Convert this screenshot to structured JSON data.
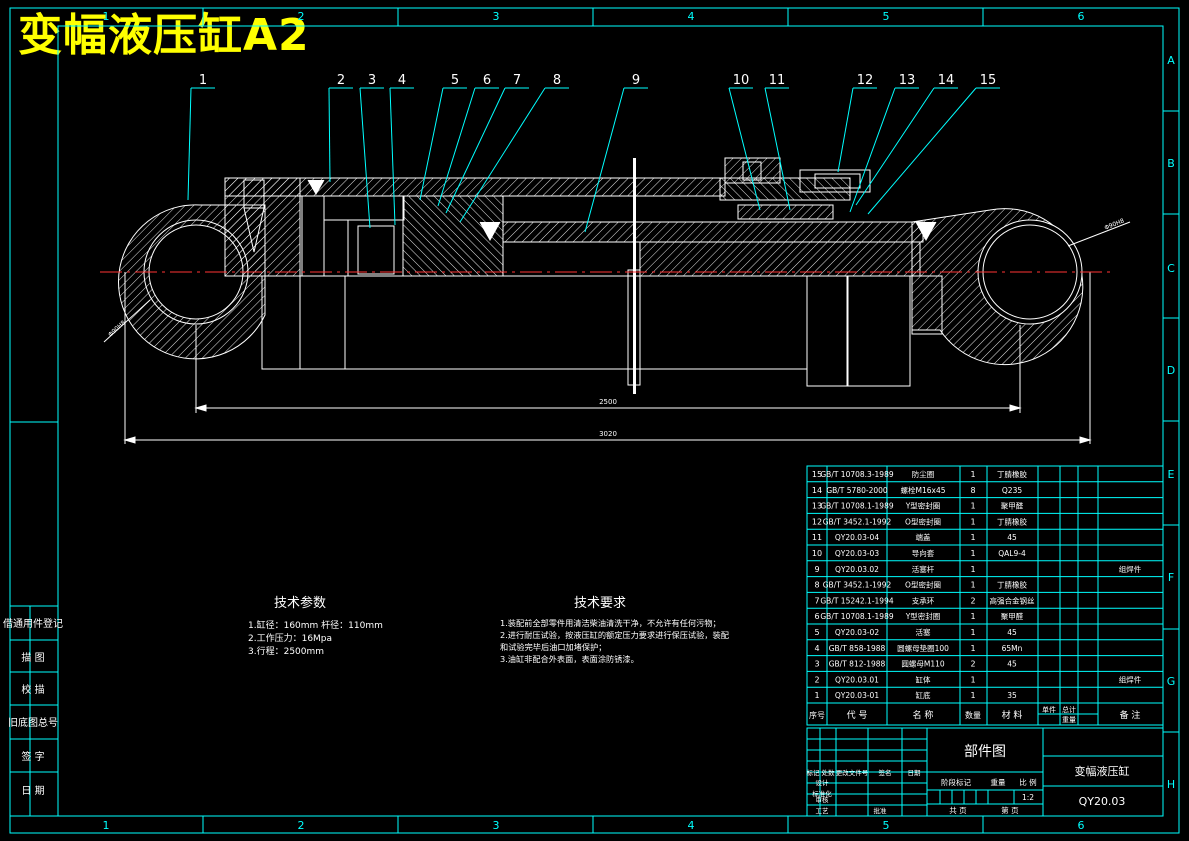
{
  "title": "变幅液压缸A2",
  "grid": {
    "cols": [
      "1",
      "2",
      "3",
      "4",
      "5",
      "6"
    ],
    "rows": [
      "A",
      "B",
      "C",
      "D",
      "E",
      "F",
      "G",
      "H"
    ]
  },
  "balloons": [
    "1",
    "2",
    "3",
    "4",
    "5",
    "6",
    "7",
    "8",
    "9",
    "10",
    "11",
    "12",
    "13",
    "14",
    "15"
  ],
  "dimensions": {
    "inner": "2500",
    "overall": "3020",
    "pin_left": "Φ90H8",
    "pin_right": "Φ90H8"
  },
  "side_labels": [
    "借通用件登记",
    "描 图",
    "校 描",
    "旧底图总号",
    "签 字",
    "日 期"
  ],
  "tech_params": {
    "title": "技术参数",
    "lines": [
      "1.缸径：160mm 杆径：110mm",
      "2.工作压力：16Mpa",
      "3.行程：2500mm"
    ]
  },
  "tech_requirements": {
    "title": "技术要求",
    "lines": [
      "1.装配前全部零件用清洁柴油清洗干净，不允许有任何污物；",
      "2.进行耐压试验，按液压缸的额定压力要求进行保压试验，装配",
      "和试验完毕后油口加堵保护；",
      "3.油缸非配合外表面，表面涂防锈漆。"
    ]
  },
  "bom": {
    "rows": [
      [
        "15",
        "GB/T 10708.3-1989",
        "防尘圈",
        "1",
        "丁腈橡胶",
        ""
      ],
      [
        "14",
        "GB/T 5780-2000",
        "螺栓M16x45",
        "8",
        "Q235",
        ""
      ],
      [
        "13",
        "GB/T 10708.1-1989",
        "Y型密封圈",
        "1",
        "聚甲醛",
        ""
      ],
      [
        "12",
        "GB/T 3452.1-1992",
        "O型密封圈",
        "1",
        "丁腈橡胶",
        ""
      ],
      [
        "11",
        "QY20.03-04",
        "端盖",
        "1",
        "45",
        ""
      ],
      [
        "10",
        "QY20.03-03",
        "导向套",
        "1",
        "QAL9-4",
        ""
      ],
      [
        "9",
        "QY20.03.02",
        "活塞杆",
        "1",
        "",
        "组焊件"
      ],
      [
        "8",
        "GB/T 3452.1-1992",
        "O型密封圈",
        "1",
        "丁腈橡胶",
        ""
      ],
      [
        "7",
        "GB/T 15242.1-1994",
        "支承环",
        "2",
        "高强合金钢丝",
        ""
      ],
      [
        "6",
        "GB/T 10708.1-1989",
        "Y型密封圈",
        "1",
        "聚甲醛",
        ""
      ],
      [
        "5",
        "QY20.03-02",
        "活塞",
        "1",
        "45",
        ""
      ],
      [
        "4",
        "GB/T 858-1988",
        "圆螺母垫圈100",
        "1",
        "65Mn",
        ""
      ],
      [
        "3",
        "GB/T 812-1988",
        "圆螺母M110",
        "2",
        "45",
        ""
      ],
      [
        "2",
        "QY20.03.01",
        "缸体",
        "1",
        "",
        "组焊件"
      ],
      [
        "1",
        "QY20.03-01",
        "缸底",
        "1",
        "35",
        ""
      ]
    ],
    "header": [
      "序号",
      "代 号",
      "名 称",
      "数量",
      "材 料",
      "单件",
      "总计",
      "重量",
      "备 注"
    ]
  },
  "title_block": {
    "drawing_type": "部件图",
    "name": "变幅液压缸",
    "code": "QY20.03",
    "scale_label": "比 例",
    "scale": "1:2",
    "stage_label": "阶段标记",
    "weight_label": "重量",
    "sheet_label": "共 页",
    "page_label": "第 页",
    "rev_row": [
      "标记",
      "处数",
      "更改文件号",
      "签名",
      "日期"
    ],
    "left_rows": [
      "设计",
      "标准化",
      "审核",
      "工艺",
      "批准"
    ]
  },
  "colors": {
    "frame": "#00ffff",
    "outline": "#ffffff",
    "hatch": "#ffffff",
    "centerline": "#ff3333",
    "title": "#ffff00",
    "text": "#ffffff"
  }
}
